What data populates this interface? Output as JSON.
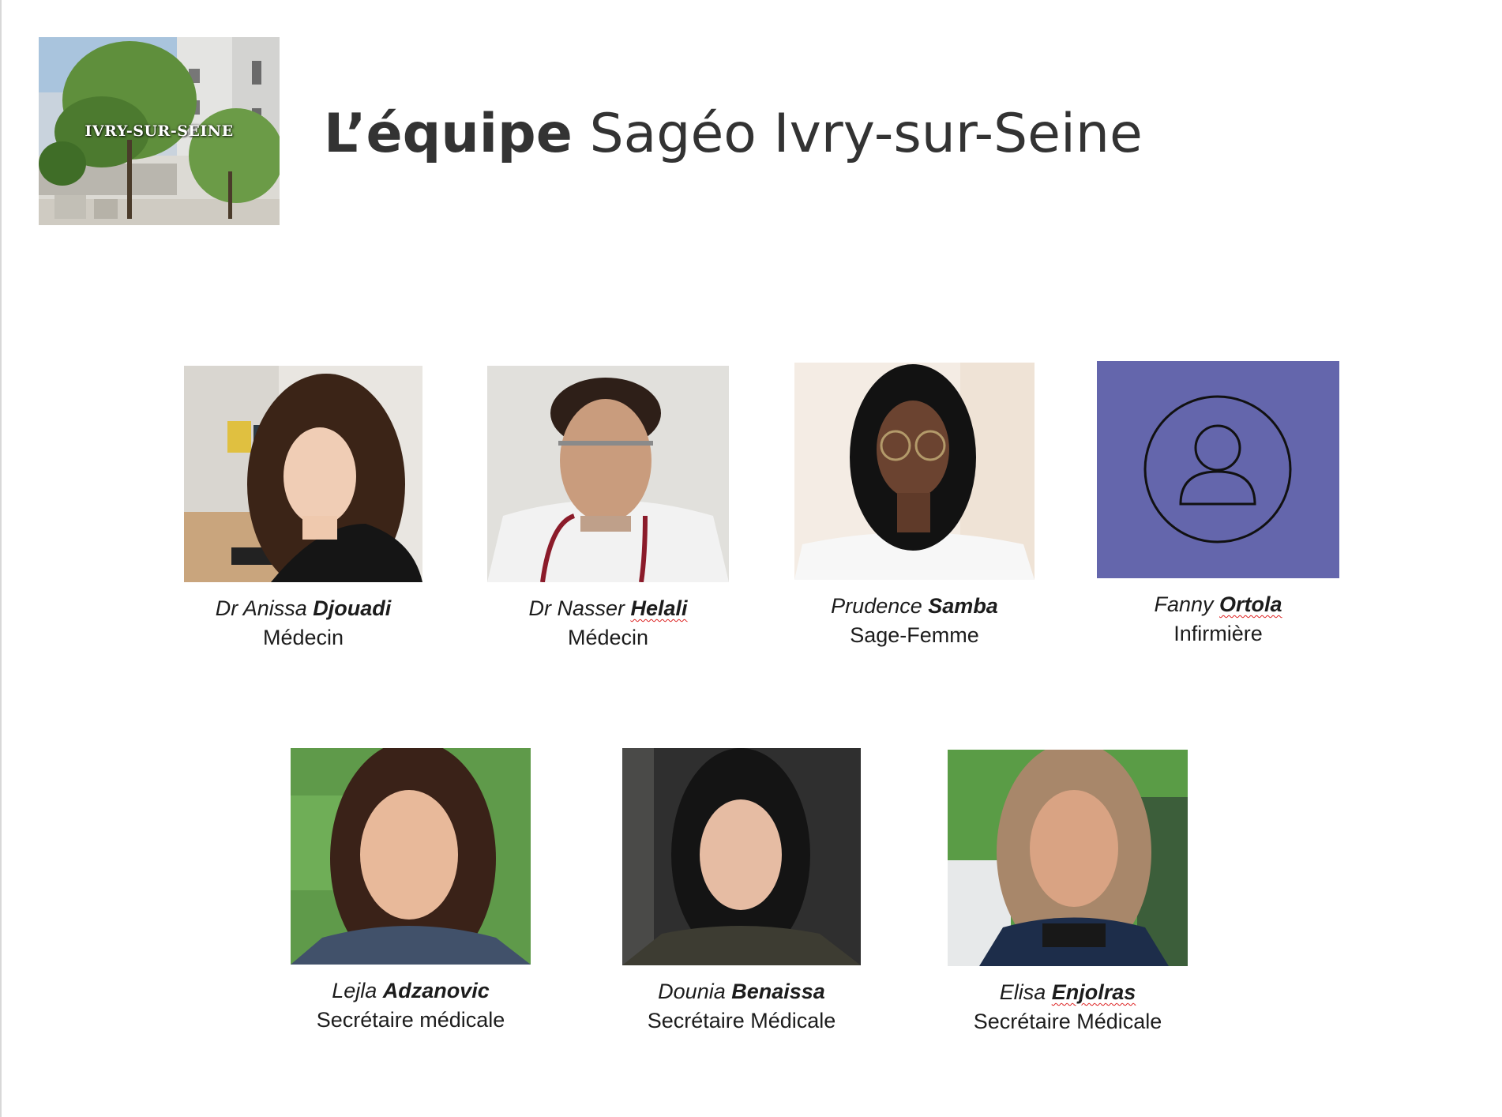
{
  "header": {
    "logo_label": "IVRY-SUR-SEINE",
    "title_bold": "L’équipe",
    "title_rest": " Sagéo Ivry-sur-Seine"
  },
  "team": [
    {
      "first": "Dr Anissa",
      "last": "Djouadi",
      "role": "Médecin",
      "photo": "doctor-photo"
    },
    {
      "first": "Dr Nasser",
      "last": "Helali",
      "role": "Médecin",
      "photo": "doctor-photo"
    },
    {
      "first": "Prudence",
      "last": "Samba",
      "role": "Sage-Femme",
      "photo": "midwife-photo"
    },
    {
      "first": "Fanny",
      "last": "Ortola",
      "role": "Infirmière",
      "photo": "user-placeholder-icon"
    },
    {
      "first": "Lejla",
      "last": "Adzanovic",
      "role": "Secrétaire médicale",
      "photo": "secretary-photo"
    },
    {
      "first": "Dounia",
      "last": "Benaissa",
      "role": "Secrétaire Médicale",
      "photo": "secretary-photo"
    },
    {
      "first": "Elisa",
      "last": "Enjolras",
      "role": "Secrétaire Médicale",
      "photo": "secretary-photo"
    }
  ],
  "colors": {
    "placeholder_bg": "#6466AC",
    "title_text": "#333333",
    "spellcheck_underline": "#DD2222"
  }
}
